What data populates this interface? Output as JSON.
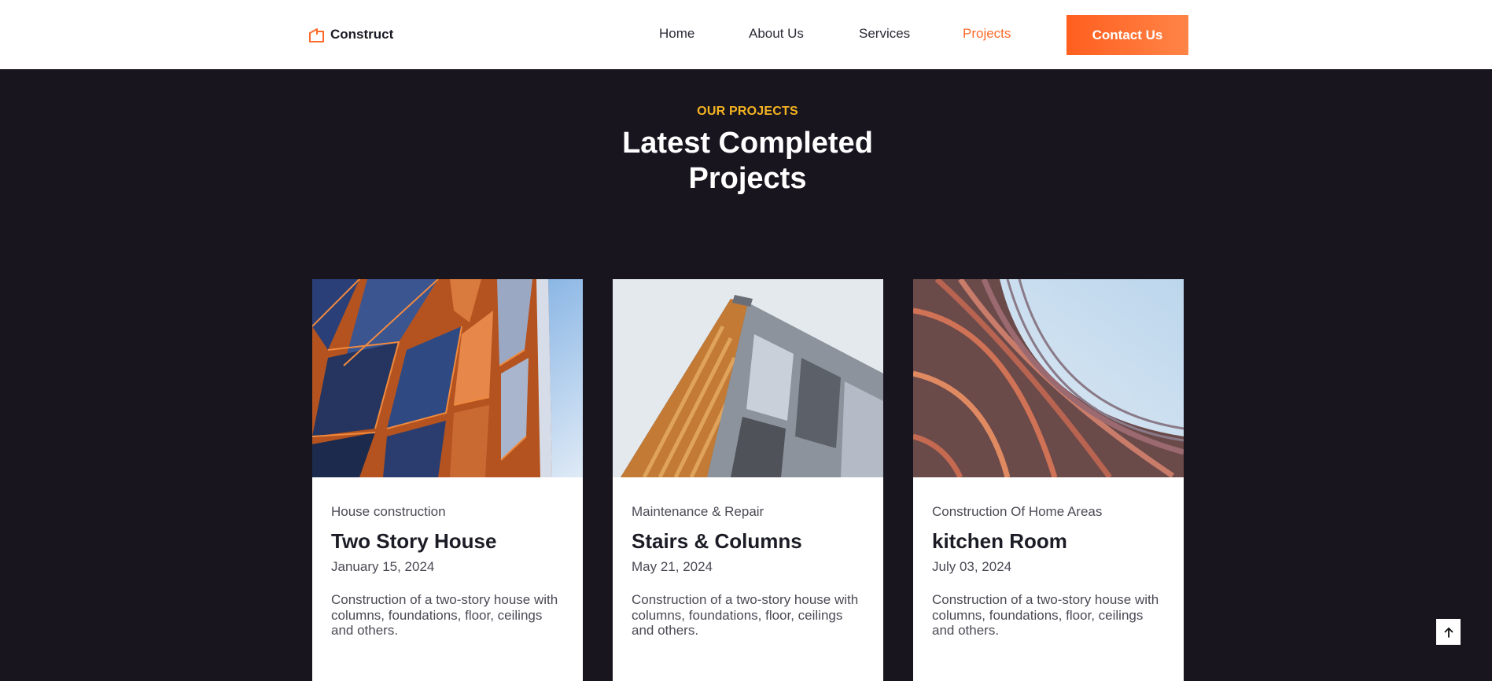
{
  "brand": {
    "name": "Construct",
    "icon": "house-logo-icon",
    "accent": "#ff6a2a"
  },
  "nav": {
    "items": [
      {
        "label": "Home",
        "active": false
      },
      {
        "label": "About Us",
        "active": false
      },
      {
        "label": "Services",
        "active": false
      },
      {
        "label": "Projects",
        "active": true
      }
    ],
    "cta_label": "Contact Us"
  },
  "section": {
    "eyebrow": "OUR PROJECTS",
    "title_line1": "Latest Completed",
    "title_line2": "Projects"
  },
  "projects": [
    {
      "category": "House construction",
      "title": "Two Story House",
      "date": "January 15, 2024",
      "description": "Construction of a two-story house with columns, foundations, floor, ceilings and others.",
      "image": "copper-glass-facade-image"
    },
    {
      "category": "Maintenance & Repair",
      "title": "Stairs & Columns",
      "date": "May 21, 2024",
      "description": "Construction of a two-story house with columns, foundations, floor, ceilings and others.",
      "image": "angular-building-facade-image"
    },
    {
      "category": "Construction Of Home Areas",
      "title": "kitchen Room",
      "date": "July 03, 2024",
      "description": "Construction of a two-story house with columns, foundations, floor, ceilings and others.",
      "image": "woven-metal-facade-image"
    }
  ],
  "scroll_top_icon": "arrow-up-icon"
}
